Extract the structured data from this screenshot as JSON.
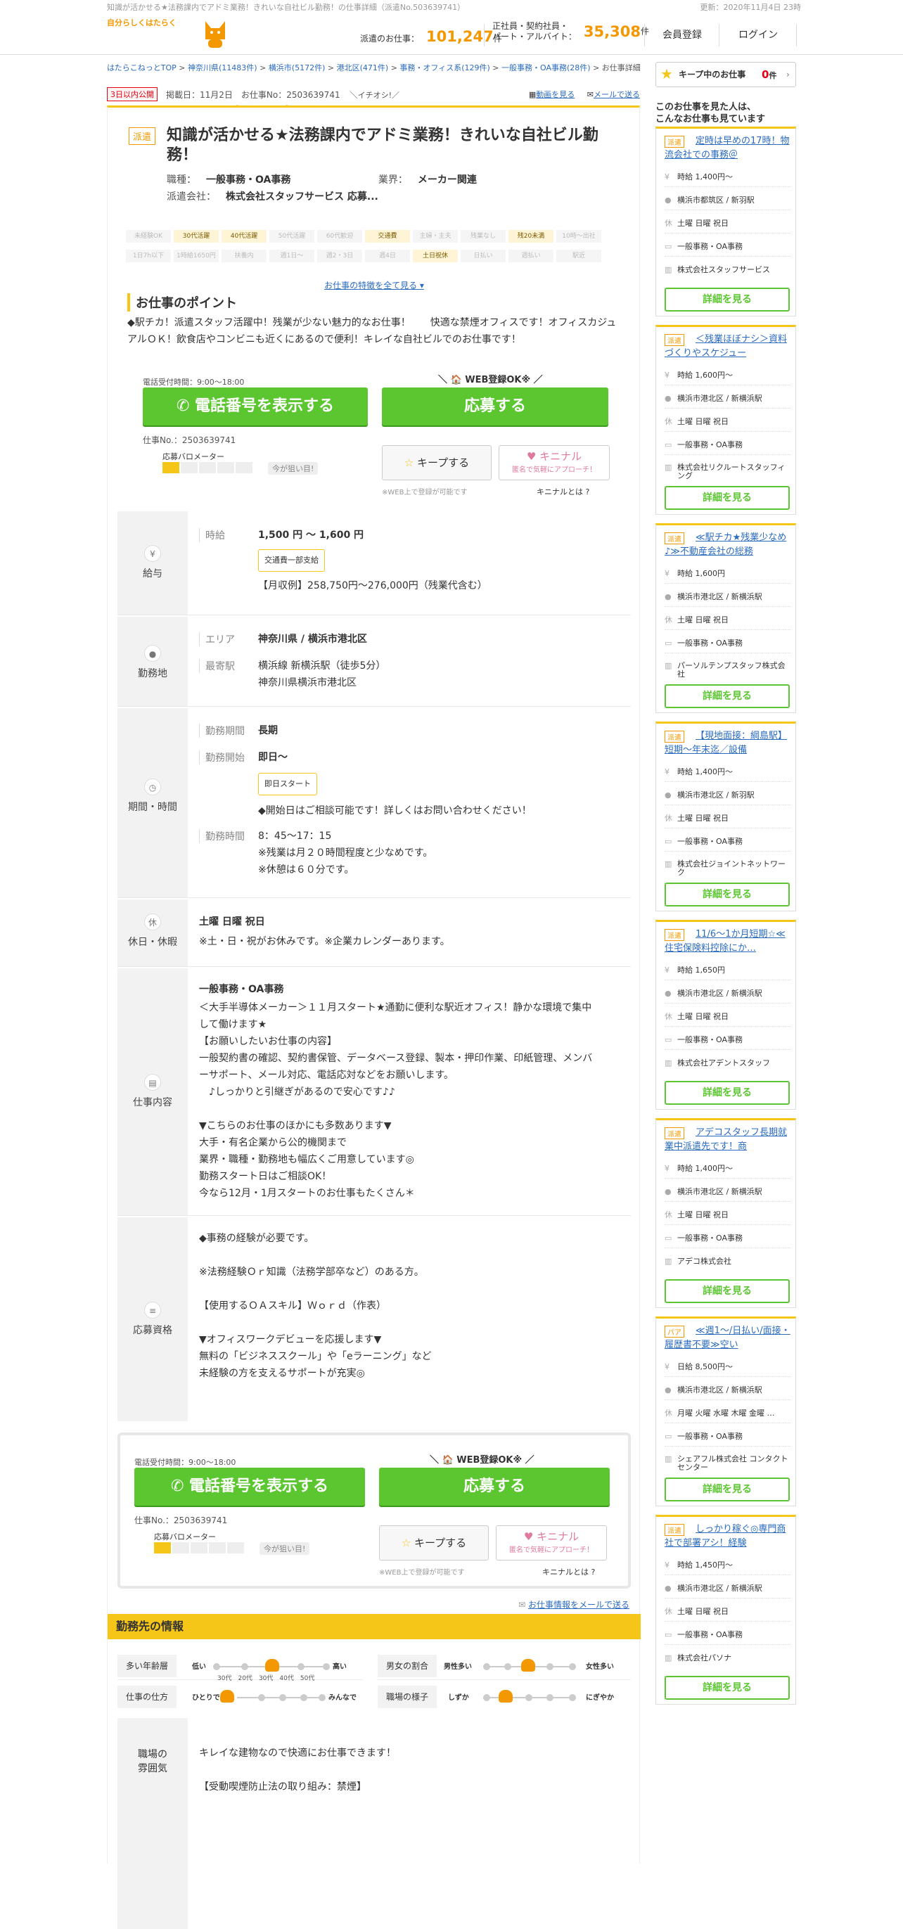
{
  "topstrip": {
    "left": "知識が活かせる★法務課内でアドミ業務！きれいな自社ビル勤務！の仕事詳細（派遣No.503639741）",
    "right": "更新：2020年11月4日 23時"
  },
  "logo": {
    "tagline": "自分らしくはたらく",
    "name": "はたらこねっと"
  },
  "header": {
    "stat1_label": "派遣のお仕事：",
    "stat1_value": "101,247",
    "stat1_unit": "件",
    "stat2_label1": "正社員・契約社員・",
    "stat2_label2": "パート・アルバイト：",
    "stat2_value": "35,308",
    "stat2_unit": "件",
    "register": "会員登録",
    "login": "ログイン"
  },
  "breadcrumb": [
    "はたらこねっとTOP",
    "神奈川県(11483件)",
    "横浜市(5172件)",
    "港北区(471件)",
    "事務・オフィス系(129件)",
    "一般事務・OA事務(28件)",
    "お仕事詳細"
  ],
  "job": {
    "new_badge": "3日以内公開",
    "posted": "掲載日：11月2日",
    "job_no_meta": "お仕事No：2503639741",
    "osusume": "＼イチオシ!／",
    "link_video": "動画を見る",
    "link_mail": "メールで送る",
    "type_badge": "派遣",
    "title": "知識が活かせる★法務課内でアドミ業務！きれいな自社ビル勤務！",
    "job_type_label": "職種：",
    "job_type": "一般事務・OA事務",
    "industry_label": "業界：",
    "industry": "メーカー関連",
    "company_label": "派遣会社：",
    "company": "株式会社スタッフサービス 応募...",
    "tags": [
      {
        "t": "未経験OK",
        "on": false
      },
      {
        "t": "30代活躍",
        "on": true
      },
      {
        "t": "40代活躍",
        "on": true
      },
      {
        "t": "50代活躍",
        "on": false
      },
      {
        "t": "60代歓迎",
        "on": false
      },
      {
        "t": "交通費",
        "on": true
      },
      {
        "t": "主婦・主夫",
        "on": false
      },
      {
        "t": "残業なし",
        "on": false
      },
      {
        "t": "残20未満",
        "on": true
      },
      {
        "t": "10時～出社",
        "on": false
      },
      {
        "t": "1日7h以下",
        "on": false
      },
      {
        "t": "1時給1650円",
        "on": false
      },
      {
        "t": "扶養内",
        "on": false
      },
      {
        "t": "週1日～",
        "on": false
      },
      {
        "t": "週2・3日",
        "on": false
      },
      {
        "t": "週4日",
        "on": false
      },
      {
        "t": "土日祝休",
        "on": true
      },
      {
        "t": "日払い",
        "on": false
      },
      {
        "t": "週払い",
        "on": false
      },
      {
        "t": "駅近",
        "on": false
      }
    ],
    "more_tags": "お仕事の特徴を全て見る ▾",
    "point_heading": "お仕事のポイント",
    "point_text": "◆駅チカ！派遣スタッフ活躍中！残業が少ない魅力的なお仕事！　　快適な禁煙オフィスです！オフィスカジュアルＯＫ！飲食店やコンビニも近くにあるので便利！キレイな自社ビルでのお仕事です！"
  },
  "actions": {
    "hours": "電話受付時間：9:00～18:00",
    "phone": "電話番号を表示する",
    "web_ok": "＼ 🏠 WEB登録OK※ ／",
    "apply": "応募する",
    "job_no": "仕事No.：2503639741",
    "meter_label": "応募バロメーター",
    "meter_now": "今が狙い目!",
    "keep": "キープする",
    "kinaru": "キニナル",
    "kinaru_sub": "匿名で気軽にアプローチ！",
    "web_note": "※WEB上で登録が可能です",
    "kinaru_what": "キニナルとは ?"
  },
  "salary": {
    "side": "給与",
    "side_icon": "¥",
    "k": "時給",
    "v": "1,500 円 ～ 1,600 円",
    "chip": "交通費一部支給",
    "monthly": "【月収例】258,750円～276,000円（残業代含む）"
  },
  "location": {
    "side": "勤務地",
    "side_icon": "●",
    "k1": "エリア",
    "v1": "神奈川県 / 横浜市港北区",
    "k2": "最寄駅",
    "v2a": "横浜線 新横浜駅（徒歩5分）",
    "v2b": "神奈川県横浜市港北区"
  },
  "period": {
    "side": "期間・時間",
    "side_icon": "◷",
    "k1": "勤務期間",
    "v1": "長期",
    "k2": "勤務開始",
    "v2": "即日～",
    "chip": "即日スタート",
    "note": "◆開始日はご相談可能です！詳しくはお問い合わせください！",
    "k3": "勤務時間",
    "v3a": "8：45～17：15",
    "v3b": "※残業は月２０時間程度と少なめです。",
    "v3c": "※休憩は６０分です。"
  },
  "holiday": {
    "side": "休日・休暇",
    "side_icon": "休",
    "v1": "土曜 日曜 祝日",
    "v2": "※土・日・祝がお休みです。※企業カレンダーあります。"
  },
  "work": {
    "side": "仕事内容",
    "side_icon": "▤",
    "title": "一般事務・OA事務",
    "lines": [
      "＜大手半導体メーカー＞１１月スタート★通勤に便利な駅近オフィス！静かな環境で集中",
      "して働けます★",
      "【お願いしたいお仕事の内容】",
      "一般契約書の確認、契約書保管、データベース登録、製本・押印作業、印紙管理、メンバ",
      "ーサポート、メール対応、電話応対などをお願いします。",
      "　♪しっかりと引継ぎがあるので安心です♪♪",
      "",
      "▼こちらのお仕事のほかにも多数あります▼",
      "大手・有名企業から公的機関まで",
      "業界・職種・勤務地も幅広くご用意しています◎",
      "勤務スタート日はご相談OK！",
      "今なら12月・1月スタートのお仕事もたくさん＊"
    ]
  },
  "qual": {
    "side": "応募資格",
    "side_icon": "≡",
    "lines": [
      "◆事務の経験が必要です。",
      "",
      "※法務経験Ｏｒ知識（法務学部卒など）のある方。",
      "",
      "【使用するＯＡスキル】Ｗｏｒｄ（作表）",
      "",
      "▼オフィスワークデビューを応援します▼",
      "無料の「ビジネススクール」や「eラーニング」など",
      "未経験の方を支えるサポートが充実◎"
    ]
  },
  "mail_link": "お仕事情報をメールで送る",
  "workplace": {
    "heading": "勤務先の情報",
    "age": {
      "k": "多い年齢層",
      "lo": "低い",
      "hi": "高い",
      "ages": [
        "30代",
        "20代",
        "30代",
        "40代",
        "50代"
      ],
      "level": 2
    },
    "gender": {
      "k": "男女の割合",
      "lo": "男性多い",
      "hi": "女性多い",
      "level": 2
    },
    "style": {
      "k": "仕事の仕方",
      "lo": "ひとりで",
      "hi": "みんなで",
      "level": 0
    },
    "mood": {
      "k": "職場の様子",
      "lo": "しずか",
      "hi": "にぎやか",
      "level": 1
    },
    "fun_side1": "職場の",
    "fun_side2": "雰囲気",
    "fun1": "キレイな建物なので快適にお仕事できます！",
    "fun2": "【受動喫煙防止法の取り組み：禁煙】"
  },
  "sidebar": {
    "keep_label": "キープ中のお仕事",
    "keep_count": "0",
    "keep_unit": "件",
    "also1": "このお仕事を見た人は、",
    "also2": "こんなお仕事も見ています",
    "detail": "詳細を見る",
    "cards": [
      {
        "badge": "派遣",
        "title": "定時は早めの17時！物流会社での事務＠",
        "wage": "時給 1,400円～",
        "place": "横浜市都筑区 / 新羽駅",
        "days": "土曜 日曜 祝日",
        "type": "一般事務・OA事務",
        "company": "株式会社スタッフサービス"
      },
      {
        "badge": "派遣",
        "title": "＜残業ほぼナシ＞資料づくりやスケジュー",
        "wage": "時給 1,600円～",
        "place": "横浜市港北区 / 新横浜駅",
        "days": "土曜 日曜 祝日",
        "type": "一般事務・OA事務",
        "company": "株式会社リクルートスタッフィング"
      },
      {
        "badge": "派遣",
        "title": "≪駅チカ★残業少なめ♪≫不動産会社の総務",
        "wage": "時給 1,600円",
        "place": "横浜市港北区 / 新横浜駅",
        "days": "土曜 日曜 祝日",
        "type": "一般事務・OA事務",
        "company": "パーソルテンプスタッフ株式会社"
      },
      {
        "badge": "派遣",
        "title": "【現地面接：綱島駅】短期～年末迄／設備",
        "wage": "時給 1,400円～",
        "place": "横浜市港北区 / 新羽駅",
        "days": "土曜 日曜 祝日",
        "type": "一般事務・OA事務",
        "company": "株式会社ジョイントネットワーク"
      },
      {
        "badge": "派遣",
        "title": "11/6～1か月短期☆≪住宅保険料控除にか…",
        "wage": "時給 1,650円",
        "place": "横浜市港北区 / 新横浜駅",
        "days": "土曜 日曜 祝日",
        "type": "一般事務・OA事務",
        "company": "株式会社アデントスタッフ"
      },
      {
        "badge": "派遣",
        "title": "アデコスタッフ長期就業中派遣先です！商",
        "wage": "時給 1,400円～",
        "place": "横浜市港北区 / 新横浜駅",
        "days": "土曜 日曜 祝日",
        "type": "一般事務・OA事務",
        "company": "アデコ株式会社"
      },
      {
        "badge": "パア",
        "title": "≪週1～/日払い/面接・履歴書不要≫空い",
        "wage": "日給 8,500円～",
        "place": "横浜市港北区 / 新横浜駅",
        "days": "月曜 火曜 水曜 木曜 金曜 …",
        "type": "一般事務・OA事務",
        "company": "シェアフル株式会社 コンタクトセンター"
      },
      {
        "badge": "派遣",
        "title": "しっかり稼ぐ◎専門商社で部署アシ！経験",
        "wage": "時給 1,450円～",
        "place": "横浜市港北区 / 新横浜駅",
        "days": "土曜 日曜 祝日",
        "type": "一般事務・OA事務",
        "company": "株式会社パソナ"
      }
    ]
  }
}
